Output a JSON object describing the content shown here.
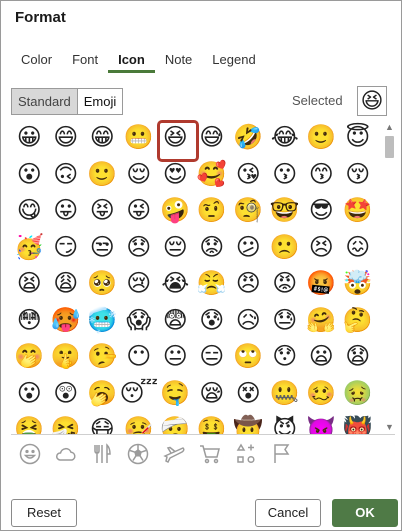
{
  "dialog": {
    "title": "Format"
  },
  "tabs": [
    {
      "label": "Color",
      "active": false
    },
    {
      "label": "Font",
      "active": false
    },
    {
      "label": "Icon",
      "active": true
    },
    {
      "label": "Note",
      "active": false
    },
    {
      "label": "Legend",
      "active": false
    }
  ],
  "icon_set": {
    "standard_label": "Standard",
    "emoji_label": "Emoji",
    "active": "Standard"
  },
  "selected": {
    "label": "Selected",
    "emoji": "😆"
  },
  "emoji_grid": [
    [
      "😀",
      "😄",
      "😁",
      "😬",
      "😆",
      "😅",
      "🤣",
      "😂",
      "🙂",
      "😇"
    ],
    [
      "😮",
      "🙃",
      "🙂",
      "😌",
      "😍",
      "🥰",
      "😘",
      "😗",
      "😙",
      "😚"
    ],
    [
      "😋",
      "😛",
      "😝",
      "😜",
      "🤪",
      "🤨",
      "🧐",
      "🤓",
      "😎",
      "🤩"
    ],
    [
      "🥳",
      "😏",
      "😒",
      "😞",
      "😔",
      "😟",
      "😕",
      "🙁",
      "😣",
      "😖"
    ],
    [
      "😫",
      "😩",
      "🥺",
      "😢",
      "😭",
      "😤",
      "😠",
      "😡",
      "🤬",
      "🤯"
    ],
    [
      "😳",
      "🥵",
      "🥶",
      "😱",
      "😨",
      "😰",
      "😥",
      "😓",
      "🤗",
      "🤔"
    ],
    [
      "🤭",
      "🤫",
      "🤥",
      "😶",
      "😐",
      "😑",
      "🙄",
      "😯",
      "😦",
      "😧"
    ],
    [
      "😮",
      "😲",
      "🥱",
      "😴",
      "🤤",
      "😪",
      "😵",
      "🤐",
      "🥴",
      "🤢"
    ],
    [
      "🤮",
      "🤧",
      "😷",
      "🤒",
      "🤕",
      "🤑",
      "🤠",
      "😈",
      "👿",
      "👹"
    ]
  ],
  "selected_cell": {
    "row": 0,
    "col": 4
  },
  "categories": [
    {
      "icon": "smiley-face-icon",
      "name": "category-smileys"
    },
    {
      "icon": "cloud-icon",
      "name": "category-nature"
    },
    {
      "icon": "fork-knife-icon",
      "name": "category-food"
    },
    {
      "icon": "soccer-ball-icon",
      "name": "category-activities"
    },
    {
      "icon": "airplane-icon",
      "name": "category-travel"
    },
    {
      "icon": "shopping-cart-icon",
      "name": "category-objects"
    },
    {
      "icon": "symbols-icon",
      "name": "category-symbols"
    },
    {
      "icon": "flag-icon",
      "name": "category-flags"
    }
  ],
  "buttons": {
    "reset": "Reset",
    "cancel": "Cancel",
    "ok": "OK"
  },
  "colors": {
    "accent": "#4f7a46",
    "selection_border": "#b03a2e",
    "icon_gray": "#9b9b9b"
  }
}
